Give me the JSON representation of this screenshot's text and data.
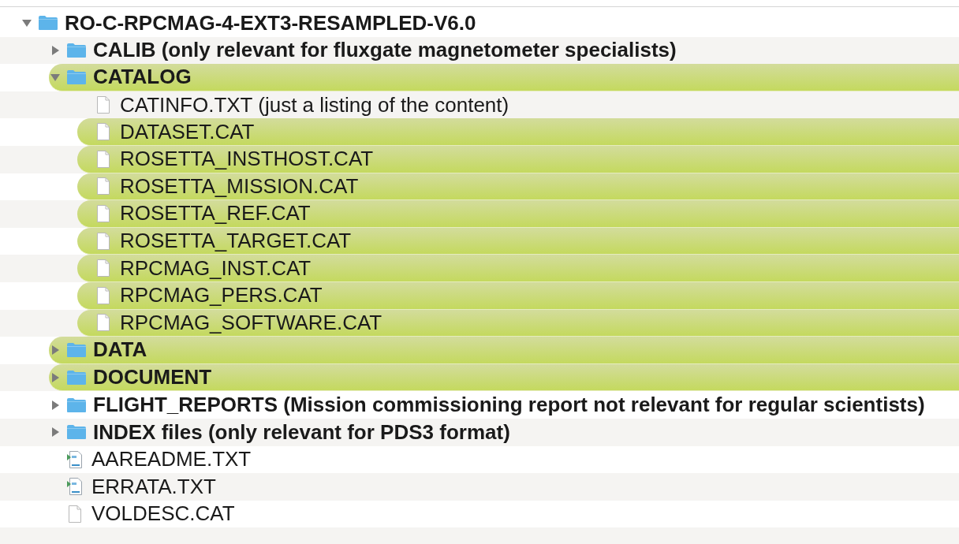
{
  "root": {
    "name": "RO-C-RPCMAG-4-EXT3-RESAMPLED-V6.0",
    "kind": "folder",
    "expanded": true,
    "tagged": false,
    "children": [
      {
        "name": "CALIB (only relevant for fluxgate magnetometer specialists)",
        "kind": "folder",
        "expanded": false,
        "tagged": false
      },
      {
        "name": "CATALOG",
        "kind": "folder",
        "expanded": true,
        "tagged": true,
        "children": [
          {
            "name": "CATINFO.TXT (just a listing of the content)",
            "kind": "file",
            "tagged": false
          },
          {
            "name": "DATASET.CAT",
            "kind": "file",
            "tagged": true
          },
          {
            "name": "ROSETTA_INSTHOST.CAT",
            "kind": "file",
            "tagged": true
          },
          {
            "name": "ROSETTA_MISSION.CAT",
            "kind": "file",
            "tagged": true
          },
          {
            "name": "ROSETTA_REF.CAT",
            "kind": "file",
            "tagged": true
          },
          {
            "name": "ROSETTA_TARGET.CAT",
            "kind": "file",
            "tagged": true
          },
          {
            "name": "RPCMAG_INST.CAT",
            "kind": "file",
            "tagged": true
          },
          {
            "name": "RPCMAG_PERS.CAT",
            "kind": "file",
            "tagged": true
          },
          {
            "name": "RPCMAG_SOFTWARE.CAT",
            "kind": "file",
            "tagged": true
          }
        ]
      },
      {
        "name": "DATA",
        "kind": "folder",
        "expanded": false,
        "tagged": true
      },
      {
        "name": "DOCUMENT",
        "kind": "folder",
        "expanded": false,
        "tagged": true
      },
      {
        "name": "FLIGHT_REPORTS (Mission commissioning report not relevant for regular scientists)",
        "kind": "folder",
        "expanded": false,
        "tagged": false
      },
      {
        "name": "INDEX files (only relevant for PDS3 format)",
        "kind": "folder",
        "expanded": false,
        "tagged": false
      },
      {
        "name": "AAREADME.TXT",
        "kind": "text",
        "tagged": false
      },
      {
        "name": "ERRATA.TXT",
        "kind": "text",
        "tagged": false
      },
      {
        "name": "VOLDESC.CAT",
        "kind": "file",
        "tagged": false
      }
    ]
  }
}
